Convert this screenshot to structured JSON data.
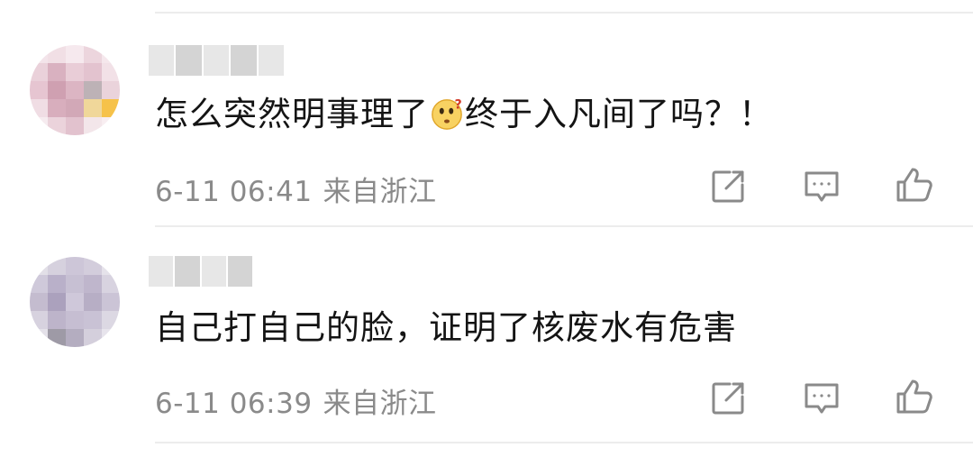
{
  "comments": [
    {
      "text_before": "怎么突然明事理了",
      "text_emoji": "thinking-face-emoji",
      "text_after": "终于入凡间了吗？！",
      "date": "6-11 06:41",
      "location": "来自浙江",
      "username": "",
      "avatar": "blurred-avatar"
    },
    {
      "text": "自己打自己的脸，证明了核废水有危害",
      "date": "6-11 06:39",
      "location": "来自浙江",
      "username": "",
      "avatar": "blurred-avatar"
    }
  ],
  "actions": [
    "share-icon",
    "comment-icon",
    "like-icon"
  ],
  "colors": {
    "text": "#141414",
    "meta": "#8a8a8a",
    "divider": "#ececec",
    "icon": "#8a8a8a"
  }
}
